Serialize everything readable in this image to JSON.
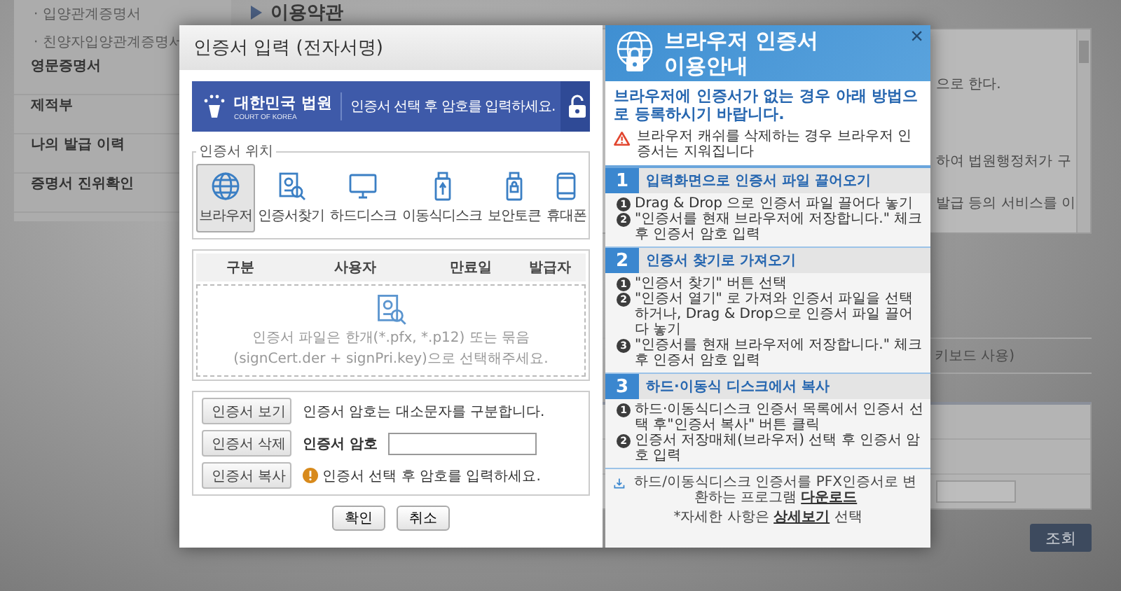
{
  "sidebar": {
    "items": [
      {
        "label": "· 입양관계증명서",
        "kind": "sub"
      },
      {
        "label": "· 친양자입양관계증명서",
        "kind": "sub"
      },
      {
        "label": "영문증명서",
        "kind": "main"
      },
      {
        "label": "제적부",
        "kind": "group"
      },
      {
        "label": "나의 발급 이력",
        "kind": "main"
      },
      {
        "label": "증명서 진위확인",
        "kind": "main"
      }
    ]
  },
  "main": {
    "section_title": "이용약관",
    "terms_lines": [
      "으로 한다.",
      "하여 법원행정처가 구",
      "발급 등의 서비스를 이"
    ],
    "option_text": "키보드 사용)",
    "search_button": "조회"
  },
  "dialog": {
    "title": "인증서 입력 (전자서명)",
    "banner": {
      "logo_text": "대한민국 법원",
      "logo_subtext": "COURT OF KOREA",
      "message": "인증서 선택 후 암호를 입력하세요."
    },
    "location": {
      "legend": "인증서 위치",
      "options": [
        {
          "label": "브라우저",
          "selected": true
        },
        {
          "label": "인증서찾기",
          "selected": false
        },
        {
          "label": "하드디스크",
          "selected": false
        },
        {
          "label": "이동식디스크",
          "selected": false
        },
        {
          "label": "보안토큰",
          "selected": false
        },
        {
          "label": "휴대폰",
          "selected": false
        }
      ]
    },
    "table": {
      "columns": [
        "구분",
        "사용자",
        "만료일",
        "발급자"
      ],
      "empty_lines": [
        "인증서 파일은 한개(*.pfx, *.p12) 또는 묶음",
        "(signCert.der + signPri.key)으로 선택해주세요."
      ]
    },
    "actions": [
      {
        "label": "인증서 보기",
        "kind": "note",
        "text": "인증서 암호는 대소문자를 구분합니다."
      },
      {
        "label": "인증서 삭제",
        "kind": "password",
        "text": "인증서 암호"
      },
      {
        "label": "인증서 복사",
        "kind": "warning",
        "text": "인증서 선택 후 암호를 입력하세요."
      }
    ],
    "buttons": [
      "확인",
      "취소"
    ]
  },
  "guide": {
    "title_lines": [
      "브라우저 인증서",
      "이용안내"
    ],
    "close": "×",
    "intro": "브라우저에 인증서가 없는 경우 아래 방법으로 등록하시기 바랍니다.",
    "warning": "브라우저 캐쉬를 삭제하는 경우 브라우저 인증서는 지워집니다",
    "sections": [
      {
        "number": "1",
        "title": "입력화면으로 인증서 파일 끌어오기",
        "steps": [
          {
            "number": "1",
            "text": "Drag & Drop 으로 인증서 파일 끌어다 놓기"
          },
          {
            "number": "2",
            "text": "\"인증서를 현재 브라우저에 저장합니다.\" 체크 후 인증서 암호 입력"
          }
        ]
      },
      {
        "number": "2",
        "title": "인증서 찾기로 가져오기",
        "steps": [
          {
            "number": "1",
            "text": "\"인증서 찾기\" 버튼 선택"
          },
          {
            "number": "2",
            "text": "\"인증서 열기\" 로 가져와 인증서 파일을 선택 하거나, Drag & Drop으로 인증서 파일 끌어다 놓기"
          },
          {
            "number": "3",
            "text": "\"인증서를 현재 브라우저에 저장합니다.\" 체크 후 인증서 암호 입력"
          }
        ]
      },
      {
        "number": "3",
        "title": "하드·이동식 디스크에서 복사",
        "steps": [
          {
            "number": "1",
            "text": "하드·이동식디스크 인증서 목록에서 인증서 선택 후\"인증서 복사\" 버튼 클릭"
          },
          {
            "number": "2",
            "text": "인증서 저장매체(브라우저) 선택 후 인증서 암호 입력"
          }
        ]
      }
    ],
    "download": {
      "text": "하드/이동식디스크 인증서를 PFX인증서로 변환하는 프로그램",
      "link": "다운로드"
    },
    "detail": {
      "prefix": "*자세한 사항은",
      "link": "상세보기",
      "suffix": "선택"
    }
  }
}
